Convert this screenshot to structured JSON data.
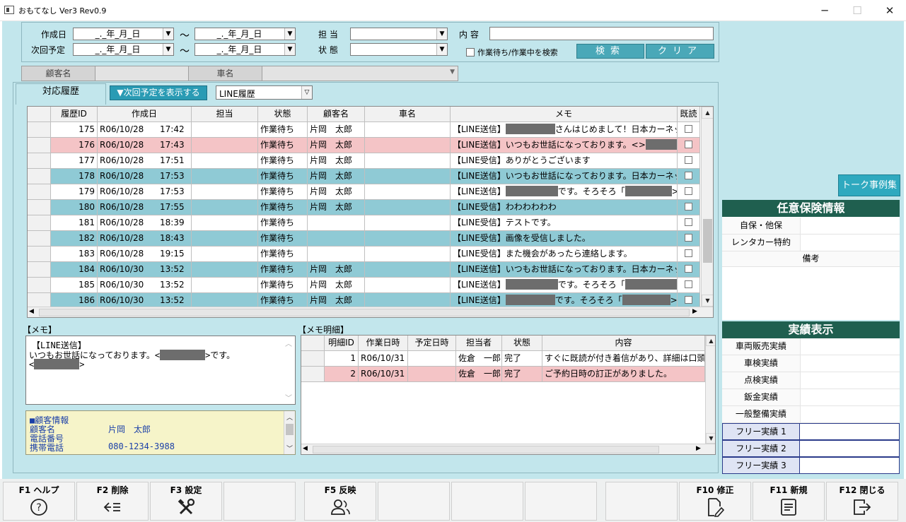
{
  "window": {
    "title": "おもてなし Ver3 Rev0.9",
    "minimize": "─",
    "maximize": "☐",
    "close": "✕"
  },
  "search": {
    "created_label": "作成日",
    "next_label": "次回予定",
    "date_placeholder": "_._年_月_日",
    "tilde": "～",
    "staff_label": "担 当",
    "status_label": "状 態",
    "content_label": "内 容",
    "waiting_checkbox_label": "作業待ち/作業中を検索",
    "search_button": "検索",
    "clear_button": "クリア"
  },
  "customer_bar": {
    "customer_label": "顧客名",
    "car_label": "車名"
  },
  "tab": {
    "label": "対応履歴",
    "show_next_button": "▼次回予定を表示する",
    "line_select_value": "LINE履歴"
  },
  "history": {
    "columns": [
      "履歴ID",
      "作成日",
      "担当",
      "状態",
      "顧客名",
      "車名",
      "メモ",
      "既読"
    ],
    "rows": [
      {
        "id": "175",
        "date": "R06/10/28",
        "time": "17:42",
        "staff": "",
        "status": "作業待ち",
        "customer": "片岡　太郎",
        "car": "",
        "memo_a": "【LINE送信】",
        "memo_b": "さんはじめまして！日本カーネット株式"
      },
      {
        "id": "176",
        "date": "R06/10/28",
        "time": "17:43",
        "staff": "",
        "status": "作業待ち",
        "customer": "片岡　太郎",
        "car": "",
        "memo_a": "【LINE送信】いつもお世話になっております。<",
        "memo_b": ">"
      },
      {
        "id": "177",
        "date": "R06/10/28",
        "time": "17:51",
        "staff": "",
        "status": "作業待ち",
        "customer": "片岡　太郎",
        "car": "",
        "memo_a": "【LINE受信】ありがとうございます",
        "memo_b": ""
      },
      {
        "id": "178",
        "date": "R06/10/28",
        "time": "17:53",
        "staff": "",
        "status": "作業待ち",
        "customer": "片岡　太郎",
        "car": "",
        "memo_a": "【LINE送信】いつもお世話になっております。日本カーネッ",
        "memo_b": ""
      },
      {
        "id": "179",
        "date": "R06/10/28",
        "time": "17:53",
        "staff": "",
        "status": "作業待ち",
        "customer": "片岡　太郎",
        "car": "",
        "memo_a": "【LINE送信】",
        "memo_b": "です。そろそろ「",
        "memo_c": ">」"
      },
      {
        "id": "180",
        "date": "R06/10/28",
        "time": "17:55",
        "staff": "",
        "status": "作業待ち",
        "customer": "片岡　太郎",
        "car": "",
        "memo_a": "【LINE受信】わわわわわわ",
        "memo_b": ""
      },
      {
        "id": "181",
        "date": "R06/10/28",
        "time": "18:39",
        "staff": "",
        "status": "作業待ち",
        "customer": "",
        "car": "",
        "memo_a": "【LINE受信】テストです。",
        "memo_b": ""
      },
      {
        "id": "182",
        "date": "R06/10/28",
        "time": "18:43",
        "staff": "",
        "status": "作業待ち",
        "customer": "",
        "car": "",
        "memo_a": "【LINE受信】画像を受信しました。",
        "memo_b": ""
      },
      {
        "id": "183",
        "date": "R06/10/28",
        "time": "19:15",
        "staff": "",
        "status": "作業待ち",
        "customer": "",
        "car": "",
        "memo_a": "【LINE受信】また機会があったら連絡します。",
        "memo_b": ""
      },
      {
        "id": "184",
        "date": "R06/10/30",
        "time": "13:52",
        "staff": "",
        "status": "作業待ち",
        "customer": "片岡　太郎",
        "car": "",
        "memo_a": "【LINE送信】いつもお世話になっております。日本カーネッ",
        "memo_b": ""
      },
      {
        "id": "185",
        "date": "R06/10/30",
        "time": "13:52",
        "staff": "",
        "status": "作業待ち",
        "customer": "片岡　太郎",
        "car": "",
        "memo_a": "【LINE送信】",
        "memo_b": "です。そろそろ「",
        "memo_c": "」"
      },
      {
        "id": "186",
        "date": "R06/10/30",
        "time": "13:52",
        "staff": "",
        "status": "作業待ち",
        "customer": "片岡　太郎",
        "car": "",
        "memo_a": "【LINE送信】",
        "memo_b": "です。そろそろ「",
        "memo_c": ">」"
      }
    ]
  },
  "memo": {
    "title": "【メモ】",
    "line1": "【LINE送信】",
    "line2_a": "いつもお世話になっております。<",
    "line2_b": ">です。",
    "line3_a": "<",
    "line3_b": ">"
  },
  "customer_info": {
    "header": "■顧客情報",
    "name_label": "顧客名",
    "name_value": "片岡　太郎",
    "phone_label": "電話番号",
    "mobile_label": "携帯電話",
    "mobile_value": "080-1234-3988"
  },
  "memo_detail": {
    "title": "【メモ明細】",
    "columns": [
      "明細ID",
      "作業日時",
      "予定日時",
      "担当者",
      "状態",
      "内容"
    ],
    "rows": [
      {
        "id": "1",
        "work_date": "R06/10/31",
        "plan_date": "",
        "staff": "佐倉　一郎",
        "status": "完了",
        "content": "すぐに既読が付き着信があり、詳細は口頭"
      },
      {
        "id": "2",
        "work_date": "R06/10/31",
        "plan_date": "",
        "staff": "佐倉　一郎",
        "status": "完了",
        "content": "ご予約日時の訂正がありました。"
      }
    ]
  },
  "talk_button": "トーク事例集",
  "insurance": {
    "title": "任意保険情報",
    "self_label": "自保・他保",
    "rental_label": "レンタカー特約",
    "notes_label": "備考"
  },
  "results": {
    "title": "実績表示",
    "rows": [
      "車両販売実績",
      "車検実績",
      "点検実績",
      "鈑金実績",
      "一般整備実績"
    ],
    "free_rows": [
      "フリー実績 1",
      "フリー実績 2",
      "フリー実績 3"
    ]
  },
  "function_keys": {
    "f1": "F1 ヘルプ",
    "f2": "F2 削除",
    "f3": "F3 設定",
    "f5": "F5 反映",
    "f10": "F10 修正",
    "f11": "F11 新規",
    "f12": "F12 閉じる"
  },
  "colors": {
    "panel_bg": "#c2e6ec",
    "row_teal": "#8fcad5",
    "row_selected": "#f4c4c6",
    "header_green": "#1f5f4f",
    "button_teal": "#2a9bb4"
  },
  "icons": [
    "help-icon",
    "delete-icon",
    "settings-icon",
    "reflect-icon",
    "edit-icon",
    "new-icon",
    "close-icon"
  ]
}
